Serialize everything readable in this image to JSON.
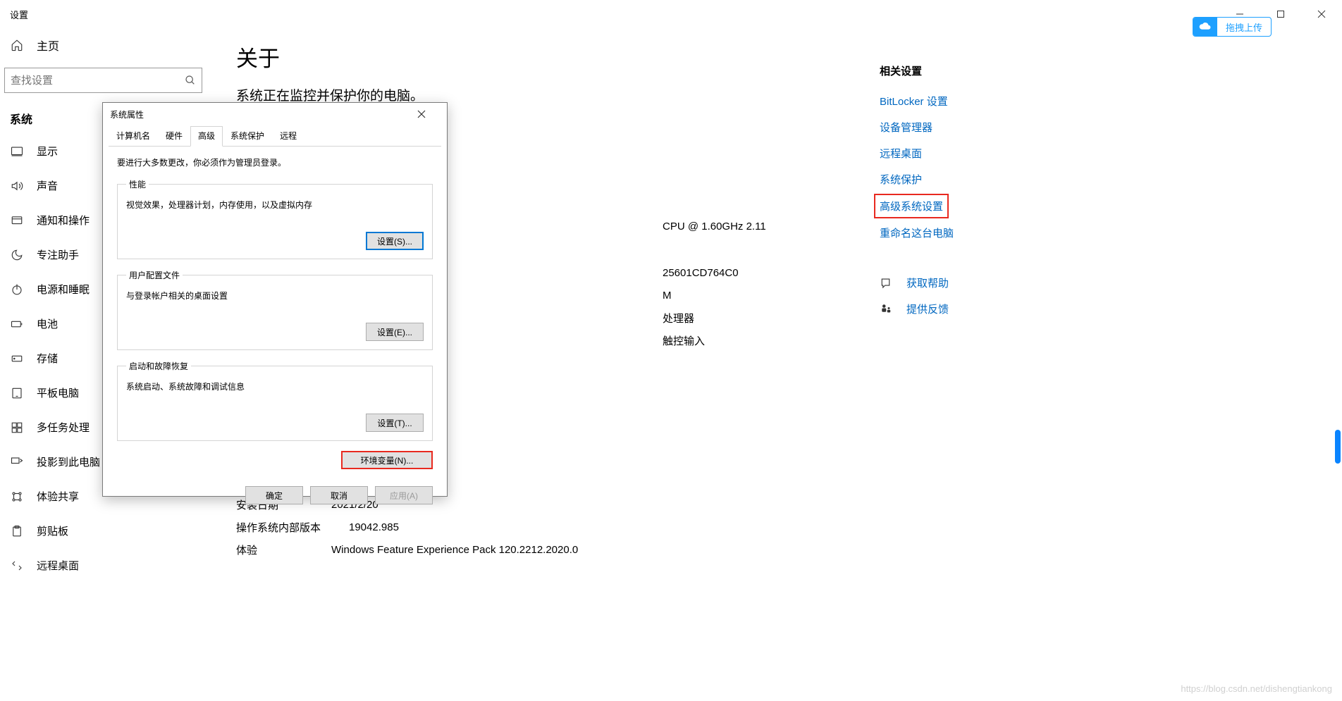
{
  "titlebar": {
    "title": "设置"
  },
  "sidebar": {
    "home": "主页",
    "search_placeholder": "查找设置",
    "section": "系统",
    "items": [
      {
        "label": "显示"
      },
      {
        "label": "声音"
      },
      {
        "label": "通知和操作"
      },
      {
        "label": "专注助手"
      },
      {
        "label": "电源和睡眠"
      },
      {
        "label": "电池"
      },
      {
        "label": "存储"
      },
      {
        "label": "平板电脑"
      },
      {
        "label": "多任务处理"
      },
      {
        "label": "投影到此电脑"
      },
      {
        "label": "体验共享"
      },
      {
        "label": "剪贴板"
      },
      {
        "label": "远程桌面"
      }
    ]
  },
  "main": {
    "title": "关于",
    "subtitle": "系统正在监控并保护你的电脑。",
    "fragments": {
      "cpu": "CPU @ 1.60GHz   2.11",
      "id_suffix": "25601CD764C0",
      "m": "M",
      "processor": "处理器",
      "touch": "触控输入"
    },
    "rows": [
      {
        "label": "安装日期",
        "value": "2021/2/20"
      },
      {
        "label": "操作系统内部版本",
        "value": "19042.985"
      },
      {
        "label": "体验",
        "value": "Windows Feature Experience Pack 120.2212.2020.0"
      }
    ]
  },
  "right": {
    "header": "相关设置",
    "links": [
      "BitLocker 设置",
      "设备管理器",
      "远程桌面",
      "系统保护",
      "高级系统设置",
      "重命名这台电脑"
    ],
    "help": "获取帮助",
    "feedback": "提供反馈"
  },
  "upload_badge": "拖拽上传",
  "watermark": "https://blog.csdn.net/dishengtiankong",
  "dialog": {
    "title": "系统属性",
    "tabs": [
      "计算机名",
      "硬件",
      "高级",
      "系统保护",
      "远程"
    ],
    "active_tab_index": 2,
    "hint": "要进行大多数更改，你必须作为管理员登录。",
    "groups": [
      {
        "legend": "性能",
        "desc": "视觉效果，处理器计划，内存使用，以及虚拟内存",
        "btn": "设置(S)...",
        "blue": true
      },
      {
        "legend": "用户配置文件",
        "desc": "与登录帐户相关的桌面设置",
        "btn": "设置(E)..."
      },
      {
        "legend": "启动和故障恢复",
        "desc": "系统启动、系统故障和调试信息",
        "btn": "设置(T)..."
      }
    ],
    "env_btn": "环境变量(N)...",
    "footer": {
      "ok": "确定",
      "cancel": "取消",
      "apply": "应用(A)"
    }
  }
}
